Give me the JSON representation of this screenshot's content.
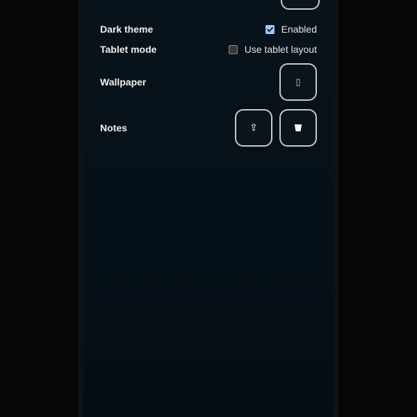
{
  "settings": {
    "dark_theme": {
      "label": "Dark theme",
      "checkbox_label": "Enabled",
      "checked": true
    },
    "tablet_mode": {
      "label": "Tablet mode",
      "checkbox_label": "Use tablet layout",
      "checked": false
    },
    "wallpaper": {
      "label": "Wallpaper",
      "button_icon": "image-icon",
      "button_glyph": "▯"
    },
    "notes": {
      "label": "Notes",
      "upload_icon": "upload-icon",
      "upload_glyph": "⇪",
      "delete_icon": "trash-icon",
      "delete_glyph": "🗑"
    }
  },
  "colors": {
    "accent": "#9cc6f5",
    "background": "#07121a",
    "button_border": "#c9c9c9"
  }
}
